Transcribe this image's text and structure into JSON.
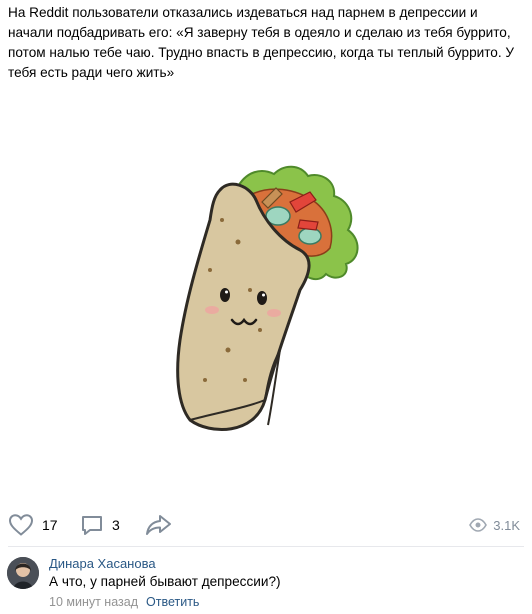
{
  "post": {
    "text": "На Reddit пользователи отказались издеваться над парнем в депрессии и начали подбадривать его: «Я заверну тебя в одеяло и сделаю из тебя буррито, потом налью тебе чаю. Трудно впасть в депрессию, когда ты теплый буррито. У тебя есть ради чего жить»",
    "image_icon": "burrito-illustration"
  },
  "actions": {
    "likes": "17",
    "comments": "3",
    "views": "3.1K",
    "icons": [
      "heart-icon",
      "comment-icon",
      "share-icon",
      "eye-icon"
    ]
  },
  "comment": {
    "author": "Динара Хасанова",
    "text": "А что, у парней бывают депрессии?)",
    "time": "10 минут назад",
    "reply": "Ответить"
  },
  "colors": {
    "link": "#2a5885",
    "muted": "#818c99",
    "divider": "#e7e8ec"
  }
}
